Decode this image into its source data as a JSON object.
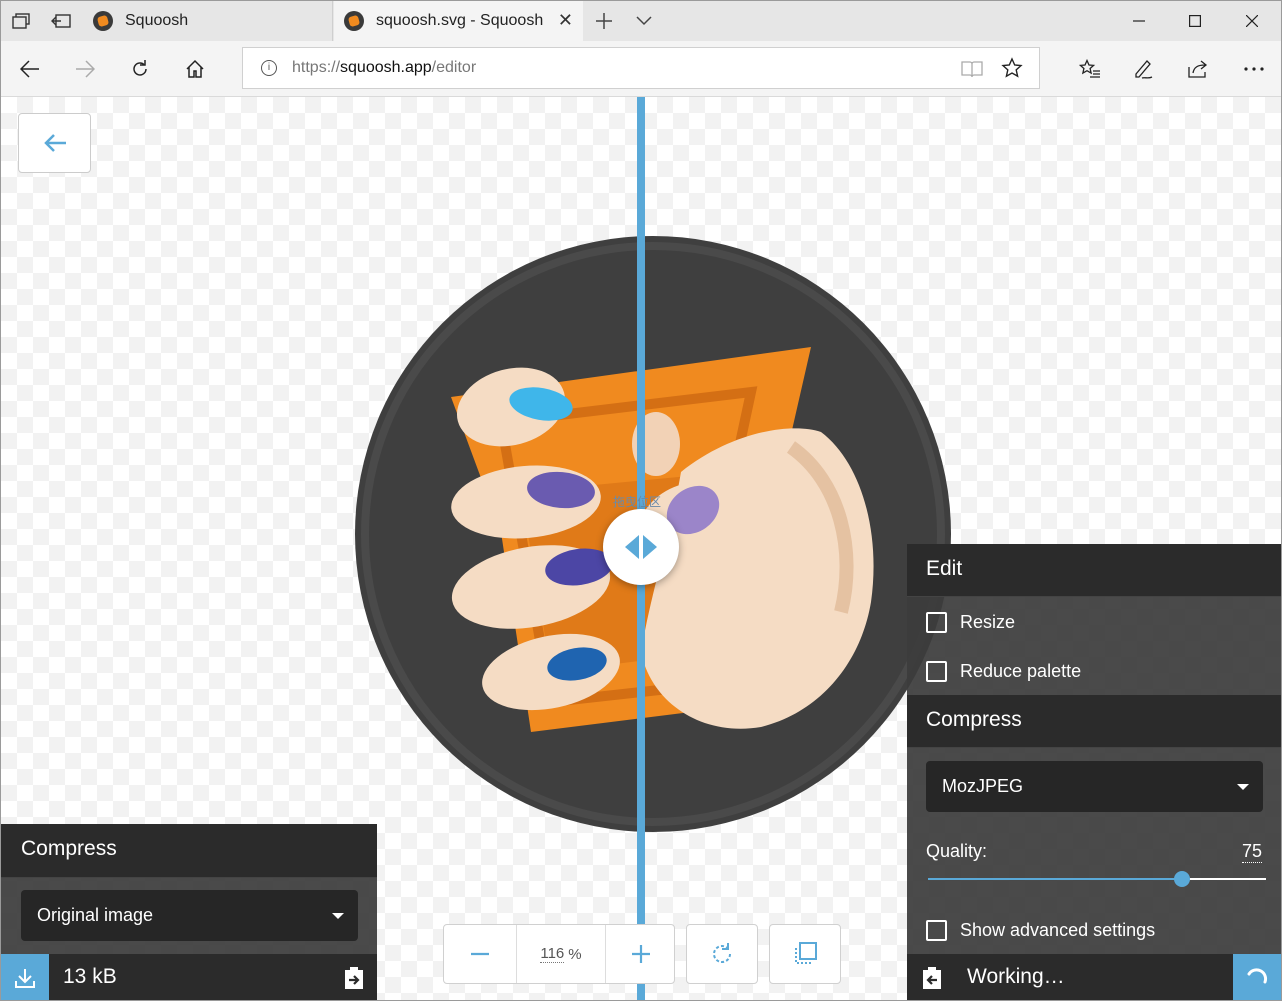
{
  "browser": {
    "tabs": [
      {
        "label": "Squoosh",
        "active": false
      },
      {
        "label": "squoosh.svg - Squoosh",
        "active": true
      }
    ],
    "url_scheme": "https://",
    "url_host": "squoosh.app",
    "url_path": "/editor"
  },
  "viewer": {
    "divider_label": "拖曳位区",
    "zoom_value": "116",
    "zoom_unit": "%"
  },
  "left_panel": {
    "heading": "Compress",
    "encoder": "Original image",
    "file_size": "13 kB"
  },
  "right_panel": {
    "edit_heading": "Edit",
    "resize_label": "Resize",
    "reduce_palette_label": "Reduce palette",
    "compress_heading": "Compress",
    "encoder": "MozJPEG",
    "quality_label": "Quality:",
    "quality_value": "75",
    "quality_fraction": 0.75,
    "advanced_label": "Show advanced settings",
    "status": "Working…"
  },
  "colors": {
    "accent": "#5aa9d8",
    "panel_dark": "#2b2b2b",
    "art_circle": "#3f3f3f",
    "art_orange": "#f08a1f"
  }
}
